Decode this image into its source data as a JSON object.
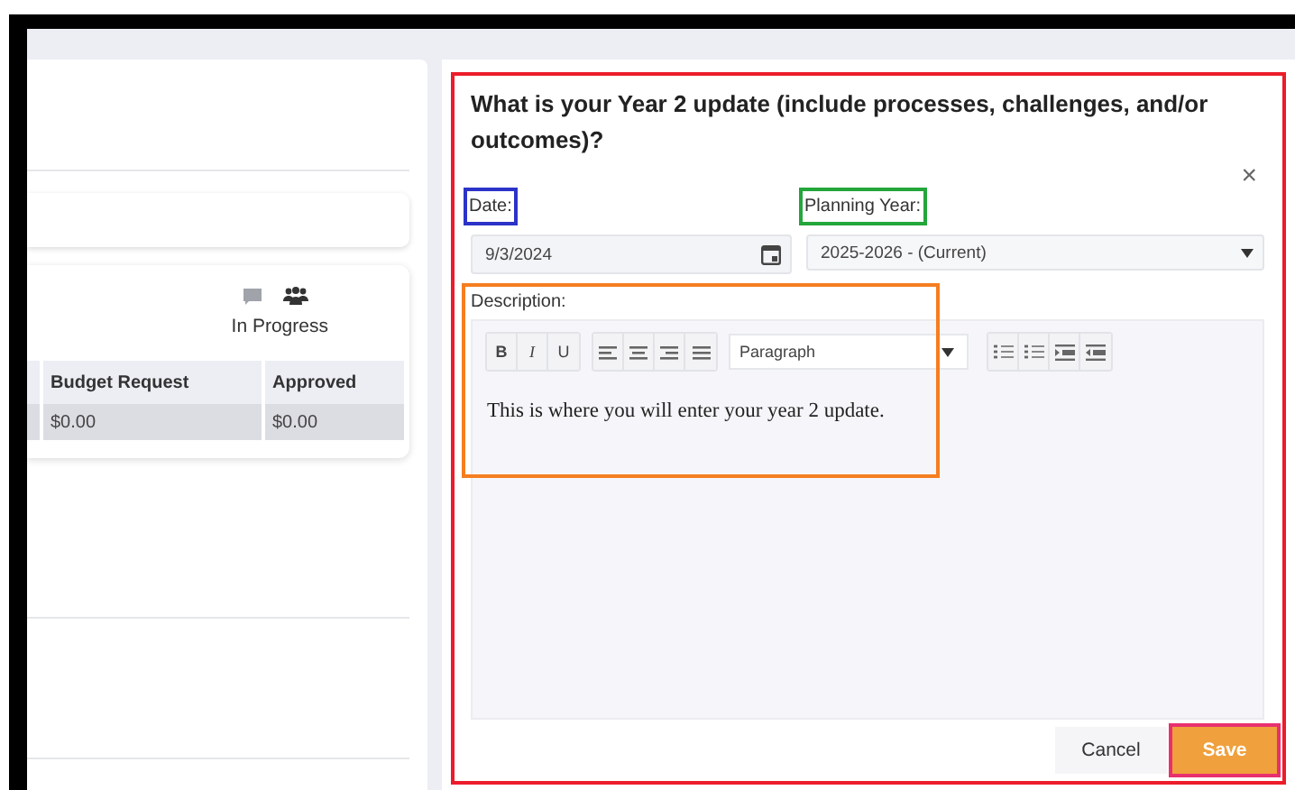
{
  "background_page": {
    "status": "In Progress",
    "table": {
      "columns": [
        "Budget Request",
        "Approved"
      ],
      "rows": [
        [
          "$0.00",
          "$0.00"
        ]
      ]
    }
  },
  "dialog": {
    "title": "What is your Year 2 update (include processes, challenges, and/or outcomes)?",
    "close": "×",
    "date": {
      "label": "Date:",
      "value": "9/3/2024"
    },
    "planning_year": {
      "label": "Planning Year:",
      "value": "2025-2026 - (Current)"
    },
    "description": {
      "label": "Description:",
      "format": "Paragraph",
      "value": "This is where you will enter your year 2 update.",
      "toolbar": [
        "B",
        "I",
        "U"
      ]
    },
    "buttons": [
      {
        "label": "Cancel",
        "kind": "secondary"
      },
      {
        "label": "Save",
        "kind": "primary"
      }
    ]
  }
}
